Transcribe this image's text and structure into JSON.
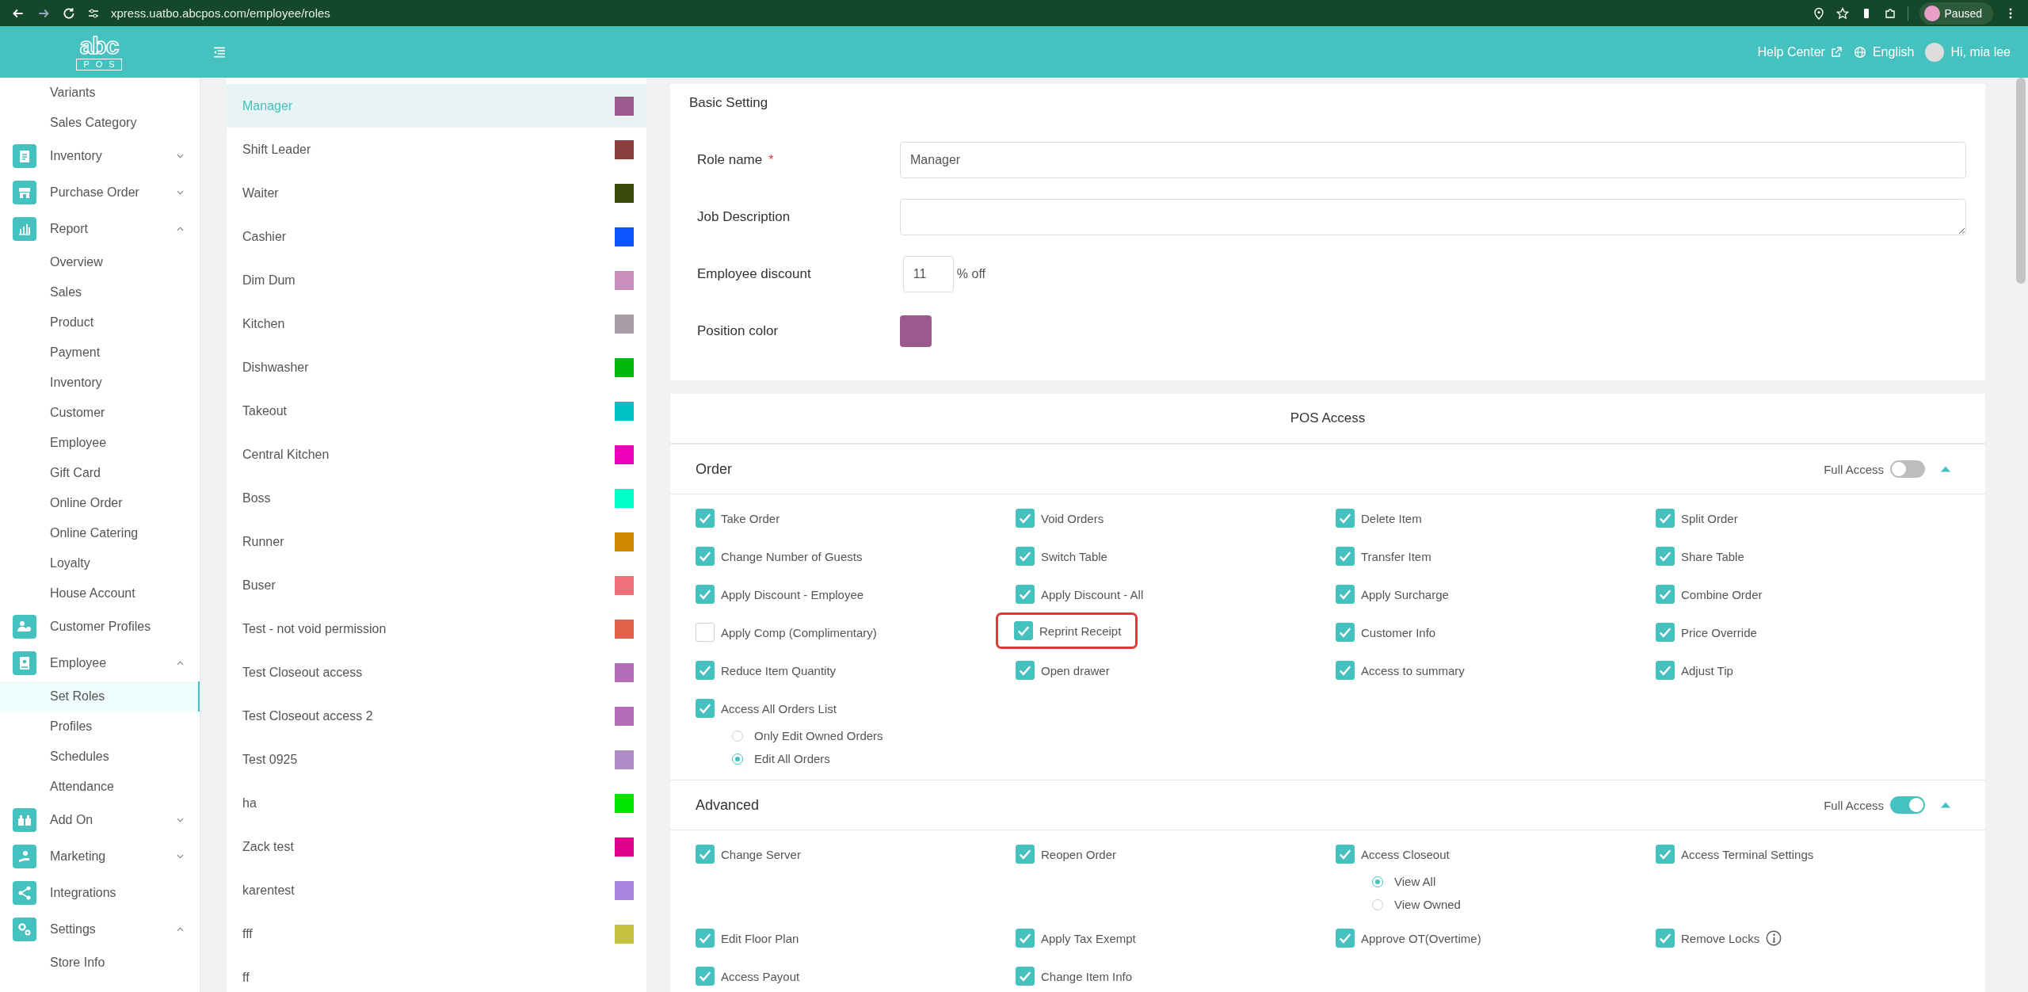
{
  "browser": {
    "url": "xpress.uatbo.abcpos.com/employee/roles",
    "profile_status": "Paused"
  },
  "header": {
    "logo_top": "abc",
    "logo_bottom": "POS",
    "help": "Help Center",
    "language": "English",
    "greeting": "Hi, mia lee"
  },
  "sidebar": {
    "items": [
      {
        "label": "Variants",
        "kind": "sub",
        "selected": false
      },
      {
        "label": "Sales Category",
        "kind": "sub",
        "selected": false
      },
      {
        "label": "Inventory",
        "kind": "group",
        "expanded": false
      },
      {
        "label": "Purchase Order",
        "kind": "group",
        "expanded": false
      },
      {
        "label": "Report",
        "kind": "group",
        "expanded": true,
        "children": [
          {
            "label": "Overview",
            "selected": false
          },
          {
            "label": "Sales",
            "selected": false
          },
          {
            "label": "Product",
            "selected": false
          },
          {
            "label": "Payment",
            "selected": false
          },
          {
            "label": "Inventory",
            "selected": false
          },
          {
            "label": "Customer",
            "selected": false
          },
          {
            "label": "Employee",
            "selected": false
          },
          {
            "label": "Gift Card",
            "selected": false
          },
          {
            "label": "Online Order",
            "selected": false
          },
          {
            "label": "Online Catering",
            "selected": false
          },
          {
            "label": "Loyalty",
            "selected": false
          },
          {
            "label": "House Account",
            "selected": false
          }
        ]
      },
      {
        "label": "Customer Profiles",
        "kind": "group"
      },
      {
        "label": "Employee",
        "kind": "group",
        "expanded": true,
        "children": [
          {
            "label": "Set Roles",
            "selected": true
          },
          {
            "label": "Profiles",
            "selected": false
          },
          {
            "label": "Schedules",
            "selected": false
          },
          {
            "label": "Attendance",
            "selected": false
          }
        ]
      },
      {
        "label": "Add On",
        "kind": "group",
        "expanded": false
      },
      {
        "label": "Marketing",
        "kind": "group",
        "expanded": false
      },
      {
        "label": "Integrations",
        "kind": "group"
      },
      {
        "label": "Settings",
        "kind": "group",
        "expanded": true,
        "children": [
          {
            "label": "Store Info",
            "selected": false
          }
        ]
      }
    ]
  },
  "roles": [
    {
      "name": "Manager",
      "color": "#9b5a8e",
      "selected": true
    },
    {
      "name": "Shift Leader",
      "color": "#8b3e3e",
      "selected": false
    },
    {
      "name": "Waiter",
      "color": "#3a4a0c",
      "selected": false
    },
    {
      "name": "Cashier",
      "color": "#0a55ff",
      "selected": false
    },
    {
      "name": "Dim Dum",
      "color": "#c98fbf",
      "selected": false
    },
    {
      "name": "Kitchen",
      "color": "#a89ca6",
      "selected": false
    },
    {
      "name": "Dishwasher",
      "color": "#00b80c",
      "selected": false
    },
    {
      "name": "Takeout",
      "color": "#00c0c4",
      "selected": false
    },
    {
      "name": "Central Kitchen",
      "color": "#f000b8",
      "selected": false
    },
    {
      "name": "Boss",
      "color": "#00ffc8",
      "selected": false
    },
    {
      "name": "Runner",
      "color": "#d08a00",
      "selected": false
    },
    {
      "name": "Buser",
      "color": "#ee7078",
      "selected": false
    },
    {
      "name": "Test - not void permission",
      "color": "#e0604a",
      "selected": false
    },
    {
      "name": "Test Closeout access",
      "color": "#b46cb8",
      "selected": false
    },
    {
      "name": "Test Closeout access 2",
      "color": "#b46cb8",
      "selected": false
    },
    {
      "name": "Test 0925",
      "color": "#ae8cc6",
      "selected": false
    },
    {
      "name": "ha",
      "color": "#00e600",
      "selected": false
    },
    {
      "name": "Zack test",
      "color": "#e0008c",
      "selected": false
    },
    {
      "name": "karentest",
      "color": "#a884e0",
      "selected": false
    },
    {
      "name": "fff",
      "color": "#c4c040",
      "selected": false
    },
    {
      "name": "ff",
      "selected": false
    }
  ],
  "basic_setting": {
    "title": "Basic Setting",
    "role_name_label": "Role name",
    "required_mark": "*",
    "role_name": "Manager",
    "job_description_label": "Job Description",
    "discount_label": "Employee discount",
    "discount": "11",
    "discount_suffix": "% off",
    "position_color_label": "Position color"
  },
  "pos_access": {
    "title": "POS Access",
    "sections": [
      {
        "title": "Order",
        "full_access_label": "Full Access",
        "full_access": false,
        "expanded": true,
        "items": [
          {
            "label": "Take Order",
            "checked": true,
            "highlighted": false
          },
          {
            "label": "Void Orders",
            "checked": true,
            "highlighted": false
          },
          {
            "label": "Delete Item",
            "checked": true,
            "highlighted": false
          },
          {
            "label": "Split Order",
            "checked": true,
            "highlighted": false
          },
          {
            "label": "Change Number of Guests",
            "checked": true,
            "highlighted": false
          },
          {
            "label": "Switch Table",
            "checked": true,
            "highlighted": false
          },
          {
            "label": "Transfer Item",
            "checked": true,
            "highlighted": false
          },
          {
            "label": "Share Table",
            "checked": true,
            "highlighted": false
          },
          {
            "label": "Apply Discount - Employee",
            "checked": true,
            "highlighted": false
          },
          {
            "label": "Apply Discount - All",
            "checked": true,
            "highlighted": false
          },
          {
            "label": "Apply Surcharge",
            "checked": true,
            "highlighted": false
          },
          {
            "label": "Combine Order",
            "checked": true,
            "highlighted": false
          },
          {
            "label": "Apply Comp (Complimentary)",
            "checked": false,
            "highlighted": false
          },
          {
            "label": "Reprint Receipt",
            "checked": true,
            "highlighted": true
          },
          {
            "label": "Customer Info",
            "checked": true,
            "highlighted": false
          },
          {
            "label": "Price Override",
            "checked": true,
            "highlighted": false
          },
          {
            "label": "Reduce Item Quantity",
            "checked": true,
            "highlighted": false
          },
          {
            "label": "Open drawer",
            "checked": true,
            "highlighted": false
          },
          {
            "label": "Access to summary",
            "checked": true,
            "highlighted": false
          },
          {
            "label": "Adjust Tip",
            "checked": true,
            "highlighted": false
          },
          {
            "label": "Access All Orders List",
            "checked": true,
            "highlighted": false,
            "options": [
              {
                "label": "Only Edit Owned Orders",
                "selected": false
              },
              {
                "label": "Edit All Orders",
                "selected": true
              }
            ]
          }
        ]
      },
      {
        "title": "Advanced",
        "full_access_label": "Full Access",
        "full_access": true,
        "expanded": true,
        "items": [
          {
            "label": "Change Server",
            "checked": true,
            "highlighted": false
          },
          {
            "label": "Reopen Order",
            "checked": true,
            "highlighted": false
          },
          {
            "label": "Access Closeout",
            "checked": true,
            "highlighted": false,
            "options": [
              {
                "label": "View All",
                "selected": true
              },
              {
                "label": "View Owned",
                "selected": false
              }
            ]
          },
          {
            "label": "Access Terminal Settings",
            "checked": true,
            "highlighted": false
          },
          {
            "label": "Edit Floor Plan",
            "checked": true,
            "highlighted": false
          },
          {
            "label": "Apply Tax Exempt",
            "checked": true,
            "highlighted": false
          },
          {
            "label": "Approve OT(Overtime)",
            "checked": true,
            "highlighted": false
          },
          {
            "label": "Remove Locks",
            "checked": true,
            "highlighted": false,
            "info": true
          },
          {
            "label": "Access Payout",
            "checked": true,
            "highlighted": false
          },
          {
            "label": "Change Item Info",
            "checked": true,
            "highlighted": false
          }
        ]
      }
    ]
  }
}
